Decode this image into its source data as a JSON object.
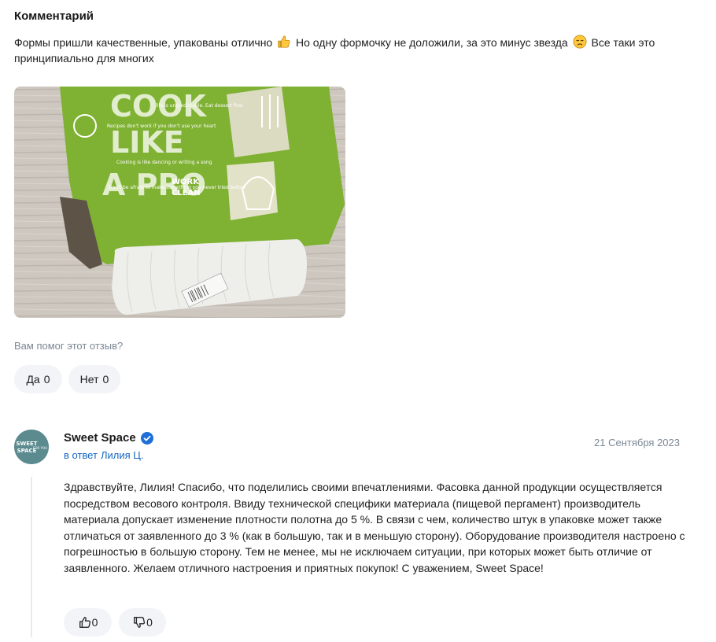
{
  "review": {
    "heading": "Комментарий",
    "text_part1": "Формы пришли качественные, упакованы отлично",
    "text_part2": "Но одну формочку не доложили, за это минус звезда",
    "text_part3": "Все таки это принципиально для многих",
    "emoji_1": "thumbs-up-icon",
    "emoji_2": "disappointed-face-icon",
    "photo_text": {
      "line1": "COOK",
      "line2": "LIKE",
      "line3": "A PRO",
      "work": "WORK",
      "clean": "CLEAN",
      "notes": [
        "life is unpredictable. Eat dessert first",
        "Recipes don't work if you don't use your heart",
        "Cooking is like dancing or writing a song",
        "Don't be afraid to make something you never tried before"
      ]
    },
    "helpful_question": "Вам помог этот отзыв?",
    "yes_label": "Да",
    "yes_count": "0",
    "no_label": "Нет",
    "no_count": "0"
  },
  "reply": {
    "avatar_text_1": "SWEET",
    "avatar_text_2": "SPACE",
    "avatar_text_3": "FOR YOU",
    "author": "Sweet Space",
    "reply_prefix": "в ответ",
    "reply_to": "Лилия Ц.",
    "date": "21 Сентября 2023",
    "text": "Здравствуйте, Лилия! Спасибо, что поделились своими впечатлениями. Фасовка данной продукции осуществляется посредством весового контроля. Ввиду технической специфики материала (пищевой пергамент) производитель материала допускает изменение плотности полотна до 5 %. В связи с чем, количество штук в упаковке может также отличаться от заявленного до 3 % (как в большую, так и в меньшую сторону). Оборудование производителя настроено с погрешностью в большую сторону. Тем не менее, мы не исключаем ситуации, при которых может быть отличие от заявленного. Желаем отличного настроения и приятных покупок! С уважением, Sweet Space!",
    "likes": "0",
    "dislikes": "0"
  },
  "colors": {
    "link": "#1565c0",
    "muted": "#7b8794",
    "button_bg": "#f2f4f7",
    "verified": "#1e6fd9",
    "box_green": "#7fb133"
  }
}
